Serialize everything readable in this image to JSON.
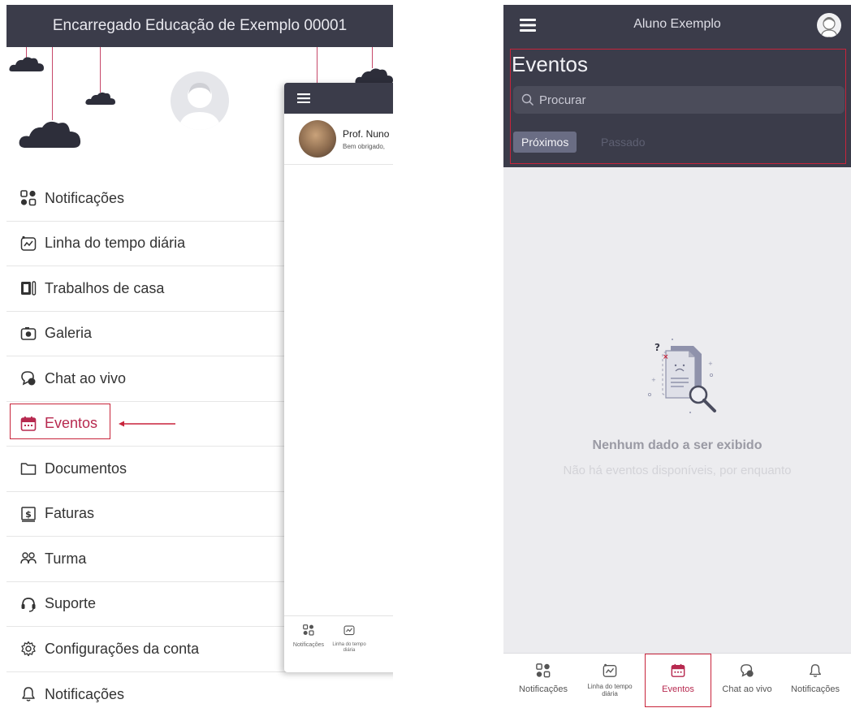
{
  "left_panel": {
    "header_title": "Encarregado Educação de Exemplo 00001",
    "menu": [
      {
        "label": "Notificações",
        "icon": "apps-grid-icon"
      },
      {
        "label": "Linha do tempo diária",
        "icon": "timeline-chart-icon"
      },
      {
        "label": "Trabalhos de casa",
        "icon": "homework-icon"
      },
      {
        "label": "Galeria",
        "icon": "camera-icon"
      },
      {
        "label": "Chat ao vivo",
        "icon": "chat-bubble-icon"
      },
      {
        "label": "Eventos",
        "icon": "calendar-icon"
      },
      {
        "label": "Documentos",
        "icon": "folder-icon"
      },
      {
        "label": "Faturas",
        "icon": "invoice-icon"
      },
      {
        "label": "Turma",
        "icon": "people-icon"
      },
      {
        "label": "Suporte",
        "icon": "headset-icon"
      },
      {
        "label": "Configurações da conta",
        "icon": "gear-icon"
      },
      {
        "label": "Notificações",
        "icon": "bell-icon"
      }
    ],
    "active_item": "Eventos",
    "overlay": {
      "chat_name": "Prof. Nuno",
      "chat_preview": "Bem obrigado,",
      "tabs": [
        {
          "label": "Notificações"
        },
        {
          "label": "Linha do tempo diária"
        }
      ]
    }
  },
  "right_panel": {
    "topbar_title": "Aluno Exemplo",
    "page_title": "Eventos",
    "search_placeholder": "Procurar",
    "tabs": [
      {
        "label": "Próximos",
        "selected": true
      },
      {
        "label": "Passado",
        "selected": false
      }
    ],
    "empty_title": "Nenhum dado a ser exibido",
    "empty_subtitle": "Não há eventos disponíveis, por enquanto",
    "bottom_tabs": [
      {
        "label": "Notificações",
        "icon": "apps-grid-icon"
      },
      {
        "label": "Linha do tempo diária",
        "icon": "timeline-chart-icon"
      },
      {
        "label": "Eventos",
        "icon": "calendar-icon",
        "active": true
      },
      {
        "label": "Chat ao vivo",
        "icon": "chat-bubble-icon"
      },
      {
        "label": "Notificações",
        "icon": "bell-icon"
      }
    ]
  },
  "colors": {
    "header_dark": "#3b3c4a",
    "accent": "#b7294f",
    "highlight_red": "#c8243b"
  }
}
